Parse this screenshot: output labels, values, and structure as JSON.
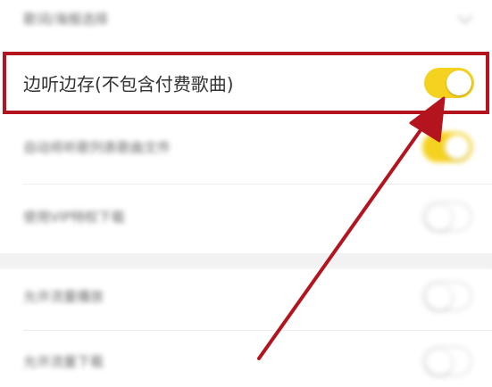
{
  "settings": {
    "rows": [
      {
        "label": "歌词/海报选择",
        "control": "chevron"
      },
      {
        "label": "边听边存(不包含付费歌曲)",
        "control": "toggle",
        "state": "on"
      },
      {
        "label": "自动将听歌列表歌曲文件",
        "control": "toggle",
        "state": "on"
      },
      {
        "label": "使用VIP特权下载",
        "control": "toggle",
        "state": "off"
      },
      {
        "label": "允许流量播放",
        "control": "toggle",
        "state": "off"
      },
      {
        "label": "允许流量下载",
        "control": "toggle",
        "state": "off"
      }
    ]
  },
  "annotation": {
    "color": "#b4141e",
    "toggle_on_color": "#f5d21f"
  }
}
